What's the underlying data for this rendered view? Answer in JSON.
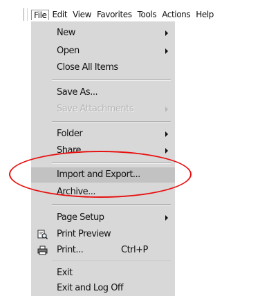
{
  "menubar": {
    "items": [
      "File",
      "Edit",
      "View",
      "Favorites",
      "Tools",
      "Actions",
      "Help"
    ]
  },
  "file_menu": {
    "new": "New",
    "open": "Open",
    "close_all": "Close All Items",
    "save_as": "Save As...",
    "save_attachments": "Save Attachments",
    "folder": "Folder",
    "share": "Share",
    "import_export": "Import and Export...",
    "archive": "Archive...",
    "page_setup": "Page Setup",
    "print_preview": "Print Preview",
    "print": "Print...",
    "print_shortcut": "Ctrl+P",
    "exit": "Exit",
    "exit_log_off": "Exit and Log Off"
  },
  "annotation": {
    "color": "#e81010"
  },
  "icons": {
    "print_preview": "print-preview-icon",
    "print": "printer-icon"
  }
}
